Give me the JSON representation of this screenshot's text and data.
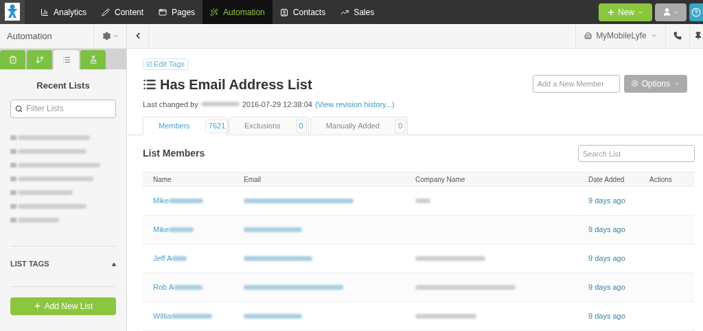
{
  "top_nav": {
    "items": [
      {
        "label": "Analytics",
        "selected": false
      },
      {
        "label": "Content",
        "selected": false
      },
      {
        "label": "Pages",
        "selected": false
      },
      {
        "label": "Automation",
        "selected": true
      },
      {
        "label": "Contacts",
        "selected": false
      },
      {
        "label": "Sales",
        "selected": false
      }
    ],
    "new_button": "New"
  },
  "subheader": {
    "section_title": "Automation",
    "account": "MyMobileLyfe"
  },
  "sidebar": {
    "tabs": [
      {
        "selected": false
      },
      {
        "selected": false
      },
      {
        "selected": true
      },
      {
        "selected": false
      }
    ],
    "heading": "Recent Lists",
    "filter_placeholder": "Filter Lists",
    "recent_lists": [
      {
        "redacted": true
      },
      {
        "redacted": true
      },
      {
        "redacted": true
      },
      {
        "redacted": true
      },
      {
        "redacted": true
      },
      {
        "redacted": true
      },
      {
        "redacted": true
      }
    ],
    "tags_heading": "LIST TAGS",
    "tags_expanded": true,
    "add_button": "Add New List"
  },
  "main": {
    "edit_tags": "Edit Tags",
    "title": "Has Email Address List",
    "changed_prefix": "Last changed by",
    "changed_by_redacted": true,
    "changed_at": "2016-07-29 12:38:04",
    "history_link": "(View revision history...)",
    "member_placeholder": "Add a New Member",
    "options_button": "Options",
    "tabs": [
      {
        "label": "Members",
        "count": "7621",
        "selected": true
      },
      {
        "label": "Exclusions",
        "count": "0",
        "selected": false
      },
      {
        "label": "Manually Added",
        "count": "0",
        "selected": false
      }
    ],
    "section_title": "List Members",
    "search_placeholder": "Search List",
    "table": {
      "columns": [
        "Name",
        "Email",
        "Company Name",
        "Date Added",
        "Actions"
      ],
      "rows": [
        {
          "name": "Mike",
          "name_redacted": true,
          "email_redacted": true,
          "company_redacted": true,
          "date": "9 days ago"
        },
        {
          "name": "Mike",
          "name_redacted": true,
          "email_redacted": true,
          "company_redacted": false,
          "date": "9 days ago"
        },
        {
          "name": "Jeff A",
          "name_redacted": true,
          "email_redacted": true,
          "company_redacted": true,
          "date": "9 days ago"
        },
        {
          "name": "Rob A",
          "name_redacted": true,
          "email_redacted": true,
          "company_redacted": true,
          "date": "9 days ago"
        },
        {
          "name": "Willia",
          "name_redacted": true,
          "email_redacted": true,
          "company_redacted": true,
          "date": "9 days ago"
        }
      ]
    }
  }
}
